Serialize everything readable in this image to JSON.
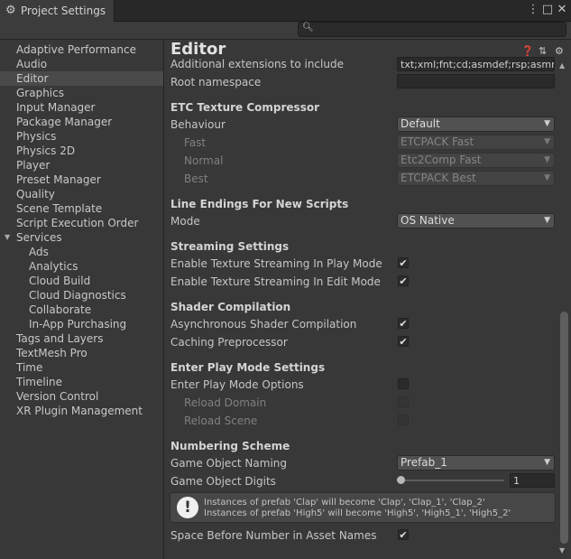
{
  "window": {
    "tab_title": "Project Settings",
    "tab_icon": "gear-icon",
    "controls": [
      "⋮",
      "□",
      "✕"
    ]
  },
  "search": {
    "value": "",
    "icon": "search-icon"
  },
  "sidebar": {
    "items": [
      {
        "label": "Adaptive Performance"
      },
      {
        "label": "Audio"
      },
      {
        "label": "Editor",
        "selected": true
      },
      {
        "label": "Graphics"
      },
      {
        "label": "Input Manager"
      },
      {
        "label": "Package Manager"
      },
      {
        "label": "Physics"
      },
      {
        "label": "Physics 2D"
      },
      {
        "label": "Player"
      },
      {
        "label": "Preset Manager"
      },
      {
        "label": "Quality"
      },
      {
        "label": "Scene Template"
      },
      {
        "label": "Script Execution Order"
      },
      {
        "label": "Services",
        "expanded": true
      },
      {
        "label": "Ads",
        "indent": 1
      },
      {
        "label": "Analytics",
        "indent": 1
      },
      {
        "label": "Cloud Build",
        "indent": 1
      },
      {
        "label": "Cloud Diagnostics",
        "indent": 1
      },
      {
        "label": "Collaborate",
        "indent": 1
      },
      {
        "label": "In-App Purchasing",
        "indent": 1
      },
      {
        "label": "Tags and Layers"
      },
      {
        "label": "TextMesh Pro"
      },
      {
        "label": "Time"
      },
      {
        "label": "Timeline"
      },
      {
        "label": "Version Control"
      },
      {
        "label": "XR Plugin Management"
      }
    ]
  },
  "main": {
    "title": "Editor",
    "header_icons": [
      "help-icon",
      "presets-icon",
      "settings-icon"
    ],
    "additional_extensions": {
      "label": "Additional extensions to include",
      "value": "txt;xml;fnt;cd;asmdef;rsp;asmref"
    },
    "root_namespace": {
      "label": "Root namespace",
      "value": ""
    },
    "etc": {
      "title": "ETC Texture Compressor",
      "behaviour_label": "Behaviour",
      "behaviour_value": "Default",
      "fast_label": "Fast",
      "fast_value": "ETCPACK Fast",
      "normal_label": "Normal",
      "normal_value": "Etc2Comp Fast",
      "best_label": "Best",
      "best_value": "ETCPACK Best"
    },
    "line_endings": {
      "title": "Line Endings For New Scripts",
      "mode_label": "Mode",
      "mode_value": "OS Native"
    },
    "streaming": {
      "title": "Streaming Settings",
      "play_label": "Enable Texture Streaming In Play Mode",
      "play_checked": true,
      "edit_label": "Enable Texture Streaming In Edit Mode",
      "edit_checked": true
    },
    "shader": {
      "title": "Shader Compilation",
      "async_label": "Asynchronous Shader Compilation",
      "async_checked": true,
      "caching_label": "Caching Preprocessor",
      "caching_checked": true
    },
    "play_mode": {
      "title": "Enter Play Mode Settings",
      "options_label": "Enter Play Mode Options",
      "options_checked": false,
      "reload_domain_label": "Reload Domain",
      "reload_domain_checked": false,
      "reload_scene_label": "Reload Scene",
      "reload_scene_checked": false
    },
    "numbering": {
      "title": "Numbering Scheme",
      "naming_label": "Game Object Naming",
      "naming_value": "Prefab_1",
      "digits_label": "Game Object Digits",
      "digits_value": "1",
      "digits_slider_fraction": 0.0,
      "help_line1": "Instances of prefab 'Clap' will become 'Clap', 'Clap_1', 'Clap_2'",
      "help_line2": "Instances of prefab 'High5' will become 'High5', 'High5_1', 'High5_2'"
    },
    "space_before_number": {
      "label": "Space Before Number in Asset Names",
      "checked": true
    }
  },
  "checkmark": "✔",
  "dropdown_arrow": "▼",
  "colors": {
    "background": "#383838",
    "selected_row": "#4a4a4a",
    "field": "#2a2a2a",
    "dropdown": "#515151"
  }
}
